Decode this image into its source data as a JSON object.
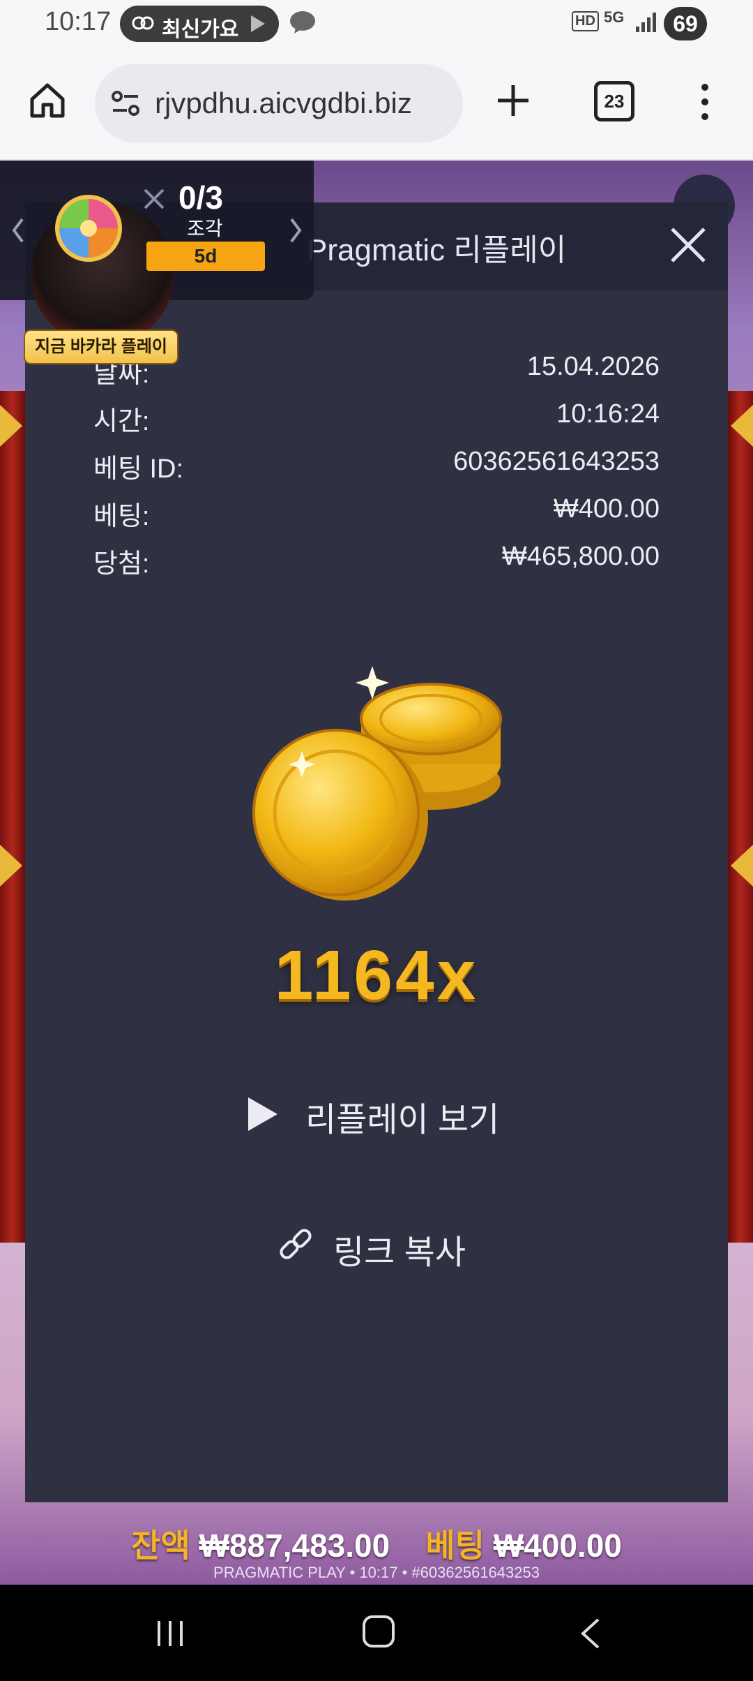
{
  "status_bar": {
    "time": "10:17",
    "pill_label": "최신가요",
    "battery": "69",
    "network": "5G",
    "hd": "HD",
    "icons": [
      "loop-icon",
      "play-icon",
      "talk-icon",
      "signal-icon",
      "battery-icon"
    ]
  },
  "browser": {
    "url": "rjvpdhu.aicvgdbi.biz",
    "tab_count": "23",
    "icons": [
      "home-icon",
      "site-settings-icon",
      "new-tab-icon",
      "tabs-icon",
      "more-menu-icon"
    ]
  },
  "promo": {
    "count": "0/3",
    "pieces_label": "조각",
    "days": "5d",
    "baccarat_button": "지금 바카라 플레이"
  },
  "modal": {
    "title": "Pragmatic 리플레이",
    "rows": [
      {
        "label": "날짜:",
        "value": "15.04.2026"
      },
      {
        "label": "시간:",
        "value": "10:16:24"
      },
      {
        "label": "베팅 ID:",
        "value": "60362561643253"
      },
      {
        "label": "베팅:",
        "value": "₩400.00"
      },
      {
        "label": "당첨:",
        "value": "₩465,800.00"
      }
    ],
    "multiplier": "1164x",
    "replay_label": "리플레이 보기",
    "copy_link_label": "링크 복사"
  },
  "balance_bar": {
    "balance_label": "잔액",
    "balance_value": "₩887,483.00",
    "bet_label": "베팅",
    "bet_value": "₩400.00",
    "footer": "PRAGMATIC PLAY • 10:17 • #60362561643253"
  },
  "colors": {
    "modal_bg": "#2f3142",
    "modal_header": "#24263a",
    "gold": "#f6b820",
    "accent_orange": "#f7a412"
  }
}
